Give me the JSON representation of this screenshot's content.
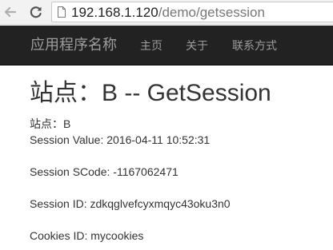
{
  "browser": {
    "url_host": "192.168.1.120",
    "url_path": "/demo/getsession",
    "back_icon": "arrow-left",
    "reload_icon": "reload",
    "page_icon": "document"
  },
  "navbar": {
    "brand": "应用程序名称",
    "links": [
      {
        "label": "主页"
      },
      {
        "label": "关于"
      },
      {
        "label": "联系方式"
      }
    ]
  },
  "main": {
    "title": "站点：B -- GetSession",
    "site_line": "站点：B",
    "session_value_line": "Session Value: 2016-04-11 10:52:31",
    "session_scode_line": "Session SCode: -1167062471",
    "session_id_line": "Session ID: zdkqglvefcyxmqyc43oku3n0",
    "cookies_id_line": "Cookies ID: mycookies"
  },
  "colors": {
    "navbar_bg": "#222222",
    "navbar_text": "#9d9d9d",
    "body_text": "#333333",
    "chrome_bg": "#f2f2f2"
  }
}
